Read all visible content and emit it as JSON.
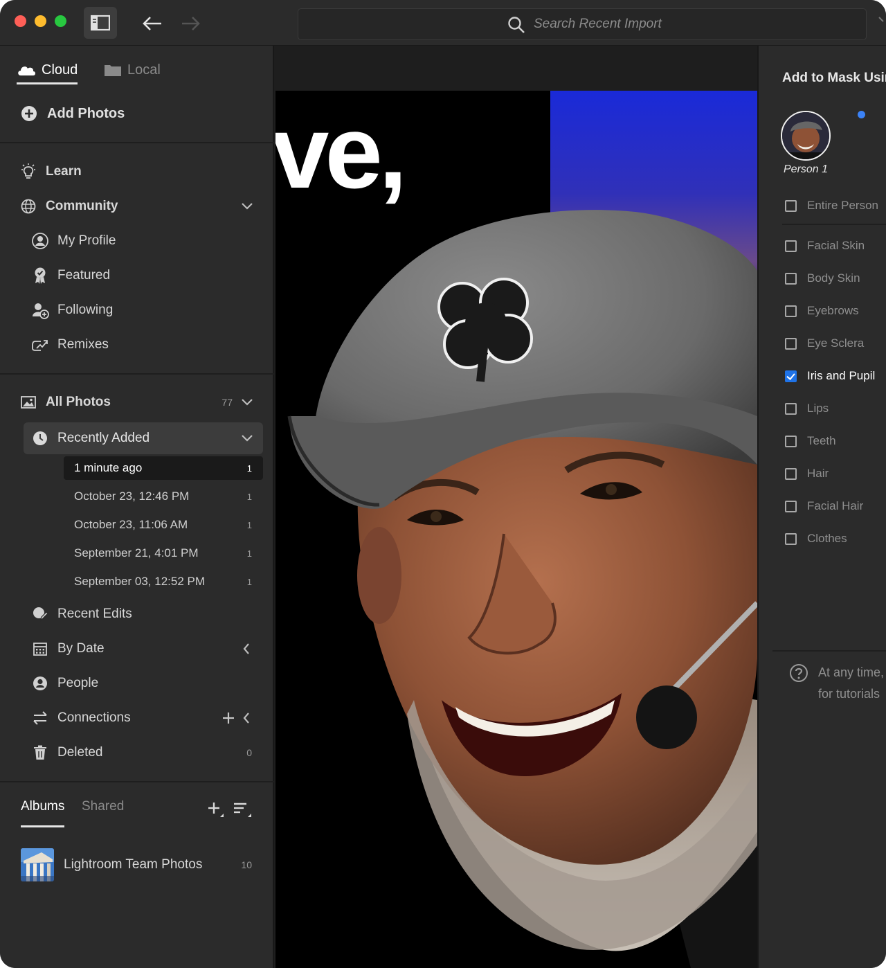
{
  "titlebar": {
    "search_placeholder": "Search Recent Import"
  },
  "sidebar": {
    "tabs": {
      "cloud": "Cloud",
      "local": "Local"
    },
    "add_photos": "Add Photos",
    "learn": "Learn",
    "community": {
      "label": "Community",
      "items": [
        "My Profile",
        "Featured",
        "Following",
        "Remixes"
      ]
    },
    "all_photos": {
      "label": "All Photos",
      "count": "77"
    },
    "recently_added": {
      "label": "Recently Added",
      "items": [
        {
          "label": "1 minute ago",
          "count": "1"
        },
        {
          "label": "October 23, 12:46 PM",
          "count": "1"
        },
        {
          "label": "October 23, 11:06 AM",
          "count": "1"
        },
        {
          "label": "September 21, 4:01 PM",
          "count": "1"
        },
        {
          "label": "September 03, 12:52 PM",
          "count": "1"
        }
      ]
    },
    "recent_edits": "Recent Edits",
    "by_date": "By Date",
    "people": "People",
    "connections": "Connections",
    "deleted": {
      "label": "Deleted",
      "count": "0"
    },
    "albums": {
      "tab_albums": "Albums",
      "tab_shared": "Shared",
      "items": [
        {
          "name": "Lightroom Team Photos",
          "count": "10"
        }
      ]
    }
  },
  "canvas": {
    "photo_overlay_text": "ve,"
  },
  "mask_panel": {
    "title": "Add to Mask Usin",
    "person_label": "Person 1",
    "options": [
      {
        "label": "Entire Person",
        "checked": false
      },
      {
        "label": "Facial Skin",
        "checked": false
      },
      {
        "label": "Body Skin",
        "checked": false
      },
      {
        "label": "Eyebrows",
        "checked": false
      },
      {
        "label": "Eye Sclera",
        "checked": false
      },
      {
        "label": "Iris and Pupil",
        "checked": true
      },
      {
        "label": "Lips",
        "checked": false
      },
      {
        "label": "Teeth",
        "checked": false
      },
      {
        "label": "Hair",
        "checked": false
      },
      {
        "label": "Facial Hair",
        "checked": false
      },
      {
        "label": "Clothes",
        "checked": false
      }
    ],
    "help_line1": "At any time,",
    "help_line2": "for tutorials"
  },
  "colors": {
    "accent_blue": "#1f73e8",
    "window_bg": "#2b2b2b",
    "selected_dot": "#3b82f6"
  },
  "icons": [
    "cloud-icon",
    "folder-icon",
    "plus-circle-icon",
    "lightbulb-icon",
    "globe-icon",
    "user-circle-icon",
    "badge-icon",
    "user-plus-icon",
    "remix-icon",
    "image-icon",
    "clock-icon",
    "edit-icon",
    "calendar-icon",
    "people-icon",
    "connections-icon",
    "trash-icon",
    "search-icon",
    "back-arrow-icon",
    "forward-arrow-icon",
    "panel-toggle-icon",
    "help-icon"
  ]
}
